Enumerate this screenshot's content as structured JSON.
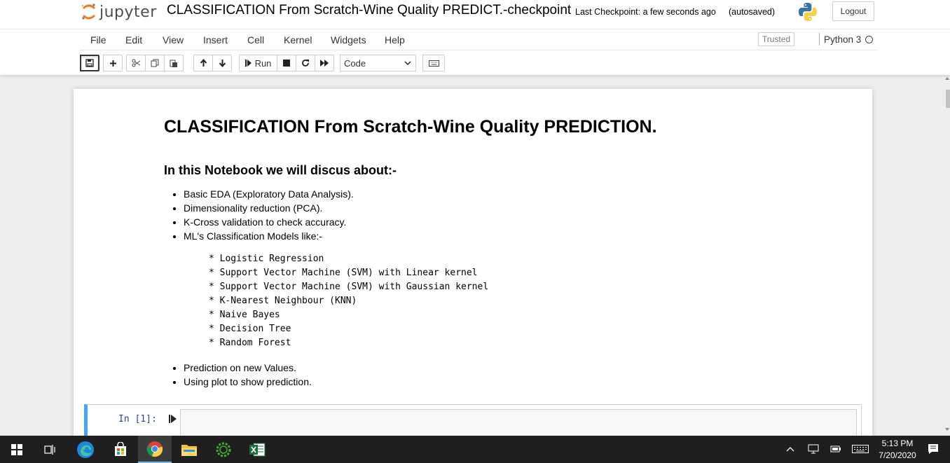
{
  "header": {
    "logo_text": "jupyter",
    "notebook_title": "CLASSIFICATION From Scratch-Wine Quality PREDICT.-checkpoint",
    "checkpoint": "Last Checkpoint: a few seconds ago",
    "autosave": "(autosaved)",
    "logout_label": "Logout"
  },
  "menubar": {
    "items": [
      "File",
      "Edit",
      "View",
      "Insert",
      "Cell",
      "Kernel",
      "Widgets",
      "Help"
    ],
    "trusted": "Trusted",
    "kernel_name": "Python 3"
  },
  "toolbar": {
    "run_label": "Run",
    "cell_type": "Code"
  },
  "notebook": {
    "title": "CLASSIFICATION From Scratch-Wine Quality PREDICTION.",
    "subtitle": "In this Notebook we will discus about:-",
    "bullets_a": [
      "Basic EDA (Exploratory Data Analysis).",
      "Dimensionality reduction (PCA).",
      "K-Cross validation to check accuracy.",
      "ML's Classification Models like:-"
    ],
    "models": [
      "* Logistic Regression",
      "* Support Vector Machine (SVM) with Linear kernel",
      "* Support Vector Machine (SVM) with Gaussian kernel",
      "* K-Nearest Neighbour (KNN)",
      "* Naive Bayes",
      "* Decision Tree",
      "* Random Forest"
    ],
    "bullets_b": [
      "Prediction on new Values.",
      "Using plot to show prediction."
    ],
    "cell_prompt": "In [1]:"
  },
  "taskbar": {
    "time": "5:13 PM",
    "date": "7/20/2020"
  },
  "colors": {
    "cell_selected": "#42a5f5",
    "prompt": "#303f9f",
    "taskbar": "#1f1f1f",
    "jupyter_orange": "#f37726"
  }
}
